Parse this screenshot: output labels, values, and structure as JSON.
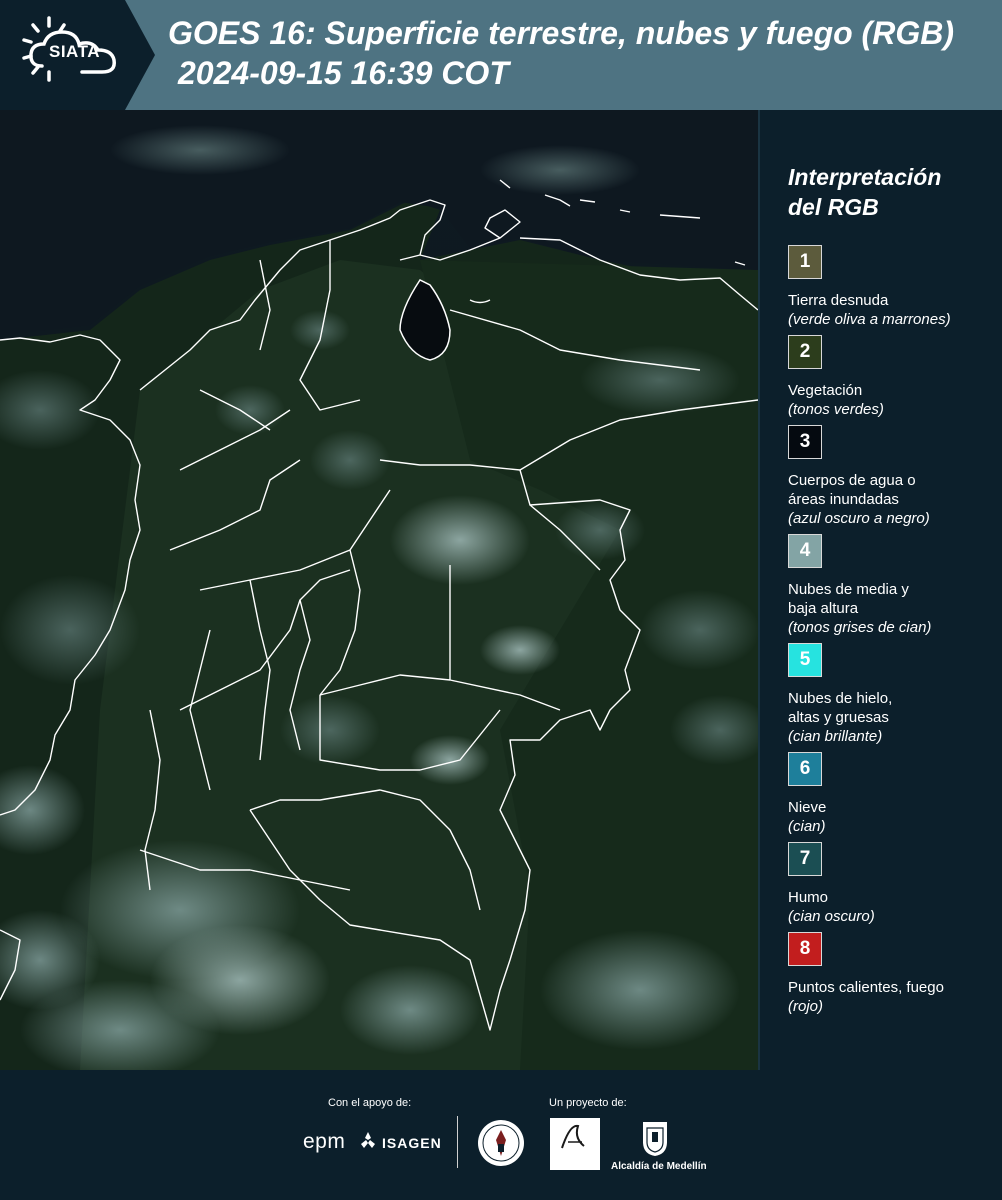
{
  "header": {
    "logo_text": "SIATA",
    "title": "GOES 16: Superficie terrestre, nubes y fuego (RGB)",
    "datetime": "2024-09-15 16:39 COT",
    "background_color": "#4e7382"
  },
  "map": {
    "icon": "satellite-composite-map",
    "background_color": "#0d1b18"
  },
  "legend": {
    "title_line1": "Interpretación",
    "title_line2": "del RGB",
    "items": [
      {
        "number": "1",
        "label": "Tierra desnuda",
        "sub": "(verde oliva a marrones)",
        "color": "#5c5b3c"
      },
      {
        "number": "2",
        "label": "Vegetación",
        "sub": "(tonos verdes)",
        "color": "#2c3d1c"
      },
      {
        "number": "3",
        "label_line1": "Cuerpos de agua o",
        "label_line2": "áreas inundadas",
        "sub": "(azul oscuro a negro)",
        "color": "#050a10"
      },
      {
        "number": "4",
        "label_line1": "Nubes de media y",
        "label_line2": "baja altura",
        "sub": "(tonos grises de cian)",
        "color": "#83a4a5"
      },
      {
        "number": "5",
        "label_line1": "Nubes de hielo,",
        "label_line2": "altas y gruesas",
        "sub": "(cian brillante)",
        "color": "#26e3e0"
      },
      {
        "number": "6",
        "label": "Nieve",
        "sub": "(cian)",
        "color": "#1e7f9b"
      },
      {
        "number": "7",
        "label": "Humo",
        "sub": "(cian oscuro)",
        "color": "#1b4e53"
      },
      {
        "number": "8",
        "label": "Puntos calientes, fuego",
        "sub": "(rojo)",
        "color": "#c21e1e"
      }
    ]
  },
  "footer": {
    "support_label": "Con el apoyo de:",
    "project_label": "Un proyecto de:",
    "epm": "epm",
    "isagen": "ISAGEN",
    "medellin": "Alcaldía de Medellín"
  }
}
